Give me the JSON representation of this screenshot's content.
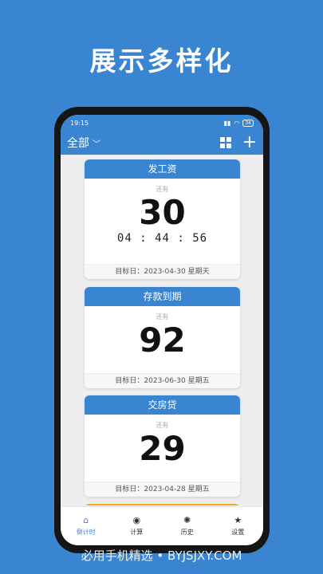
{
  "headline": "展示多样化",
  "status": {
    "time": "19:15",
    "battery": "34"
  },
  "appbar": {
    "filter_label": "全部"
  },
  "cards": [
    {
      "title": "发工资",
      "remaining": "还有",
      "days": "30",
      "time": "04 : 44 : 56",
      "target": "目标日：2023-04-30 星期天"
    },
    {
      "title": "存款到期",
      "remaining": "还有",
      "days": "92",
      "target": "目标日：2023-06-30 星期五"
    },
    {
      "title": "交房贷",
      "remaining": "还有",
      "days": "29",
      "target": "目标日：2023-04-28 星期五"
    }
  ],
  "nav": [
    {
      "label": "倒计时",
      "icon": "home-icon"
    },
    {
      "label": "计算",
      "icon": "compass-icon"
    },
    {
      "label": "历史",
      "icon": "aperture-icon"
    },
    {
      "label": "设置",
      "icon": "star-icon"
    }
  ],
  "colors": {
    "accent": "#3a85d2",
    "peek_card": "#f5a623"
  },
  "watermark": "必用手机精选 • BYJSJXY.COM"
}
